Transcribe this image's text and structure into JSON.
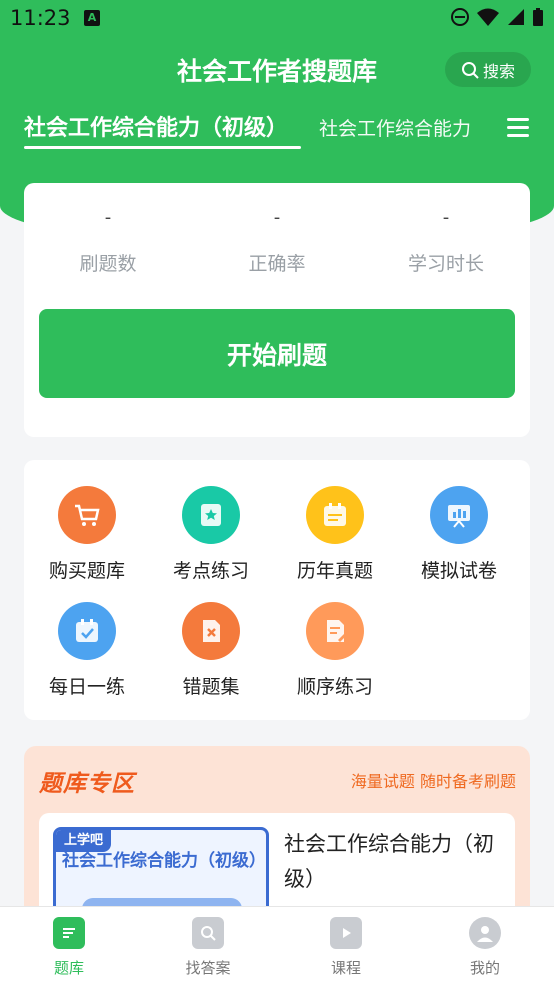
{
  "status_bar": {
    "time": "11:23",
    "badge": "A"
  },
  "header": {
    "title": "社会工作者搜题库",
    "search_label": "搜索"
  },
  "tabs": [
    {
      "label": "社会工作综合能力（初级）",
      "active": true
    },
    {
      "label": "社会工作综合能力",
      "active": false
    }
  ],
  "stats": [
    {
      "value": "-",
      "label": "刷题数"
    },
    {
      "value": "-",
      "label": "正确率"
    },
    {
      "value": "-",
      "label": "学习时长"
    }
  ],
  "start_button": "开始刷题",
  "features": [
    {
      "label": "购买题库",
      "icon": "cart-icon",
      "color": "#f47a3c"
    },
    {
      "label": "考点练习",
      "icon": "star-card-icon",
      "color": "#19c9a6"
    },
    {
      "label": "历年真题",
      "icon": "calendar-notes-icon",
      "color": "#ffc21a"
    },
    {
      "label": "模拟试卷",
      "icon": "presentation-chart-icon",
      "color": "#4da3f0"
    },
    {
      "label": "每日一练",
      "icon": "calendar-check-icon",
      "color": "#4da3f0"
    },
    {
      "label": "错题集",
      "icon": "wrong-file-icon",
      "color": "#f47a3c"
    },
    {
      "label": "顺序练习",
      "icon": "document-edit-icon",
      "color": "#ff9a5a"
    }
  ],
  "zone": {
    "title": "题库专区",
    "slogan": "海量试题 随时备考刷题",
    "book": {
      "brand": "上学吧",
      "cover_text": "社会工作综合能力（初级）",
      "title": "社会工作综合能力（初级）"
    }
  },
  "bottom_nav": [
    {
      "label": "题库",
      "icon": "question-bank-icon",
      "active": true
    },
    {
      "label": "找答案",
      "icon": "search-answer-icon",
      "active": false
    },
    {
      "label": "课程",
      "icon": "play-course-icon",
      "active": false
    },
    {
      "label": "我的",
      "icon": "user-profile-icon",
      "active": false
    }
  ],
  "colors": {
    "primary": "#2fbd5b",
    "accent_orange": "#ef5a1d",
    "zone_bg": "#fde3d6"
  }
}
